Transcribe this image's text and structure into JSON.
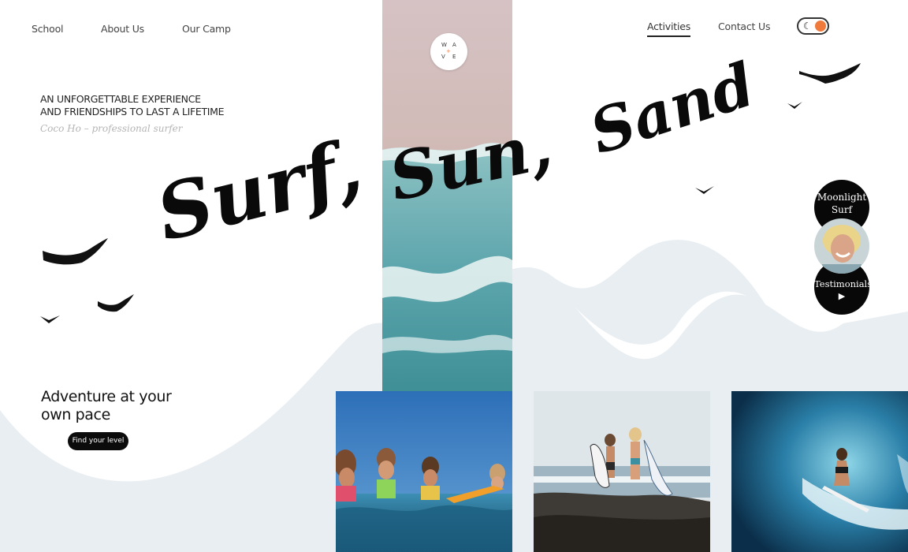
{
  "nav": {
    "left": [
      "School",
      "About Us",
      "Our Camp"
    ],
    "right": [
      "Activities",
      "Contact Us"
    ],
    "active": "Activities"
  },
  "logo": {
    "letters": [
      "W",
      "A",
      "V",
      "E"
    ],
    "dot": "+"
  },
  "theme_toggle": {
    "icon": "moon-icon",
    "state": "light"
  },
  "hero": {
    "tagline_line1": "AN UNFORGETTABLE EXPERIENCE",
    "tagline_line2": "AND FRIENDSHIPS TO LAST A LIFETIME",
    "author": "Coco Ho – professional surfer",
    "script_words": [
      "Surf,",
      "Sun,",
      "Sand"
    ]
  },
  "side_buttons": {
    "moonlight_line1": "Moonlight",
    "moonlight_line2": "Surf",
    "testimonials": "Testimonials",
    "play_icon": "▶"
  },
  "adventure": {
    "title_line1": "Adventure at your",
    "title_line2": "own pace",
    "button": "Find your level"
  },
  "colors": {
    "accent": "#f07a3c",
    "wave": "#e9eef2",
    "text": "#222222",
    "muted": "#b5b5b5",
    "dark": "#080808"
  },
  "icons": {
    "toggle": "moon-icon",
    "birds": "bird-icon",
    "play": "play-icon"
  }
}
